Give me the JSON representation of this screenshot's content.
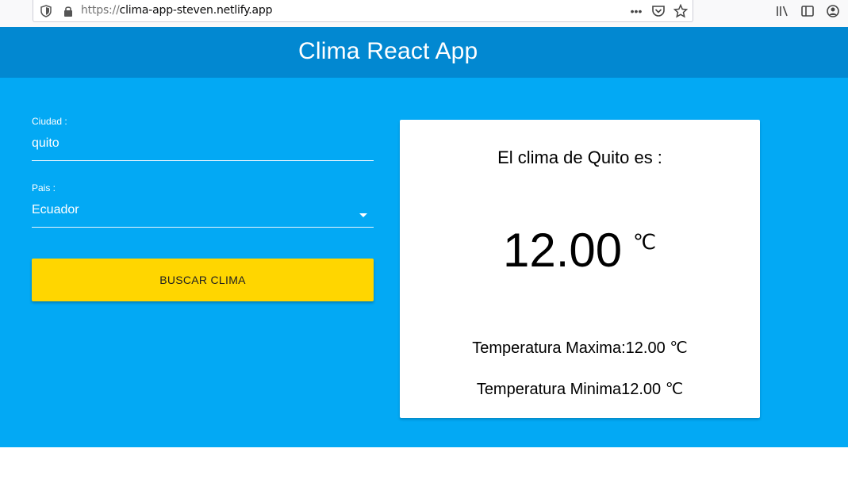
{
  "browser": {
    "url_scheme": "https://",
    "url_host": "clima-app-steven.netlify.app",
    "icons": [
      "shield-icon",
      "lock-icon",
      "more-icon",
      "pocket-icon",
      "bookmark-star-icon",
      "library-icon",
      "sidebar-icon",
      "account-icon"
    ]
  },
  "header": {
    "title": "Clima React App"
  },
  "form": {
    "city_label": "Ciudad :",
    "city_value": "quito",
    "country_label": "Pais :",
    "country_value": "Ecuador",
    "submit_label": "BUSCAR CLIMA"
  },
  "weather": {
    "title": "El clima de Quito es :",
    "temp": "12.00",
    "unit": "℃",
    "max_label": "Temperatura Maxima:12.00",
    "max_unit": "℃",
    "min_label": "Temperatura Minima12.00",
    "min_unit": "℃"
  },
  "colors": {
    "header": "#0288d1",
    "body": "#03a9f4",
    "button": "#ffd600"
  }
}
